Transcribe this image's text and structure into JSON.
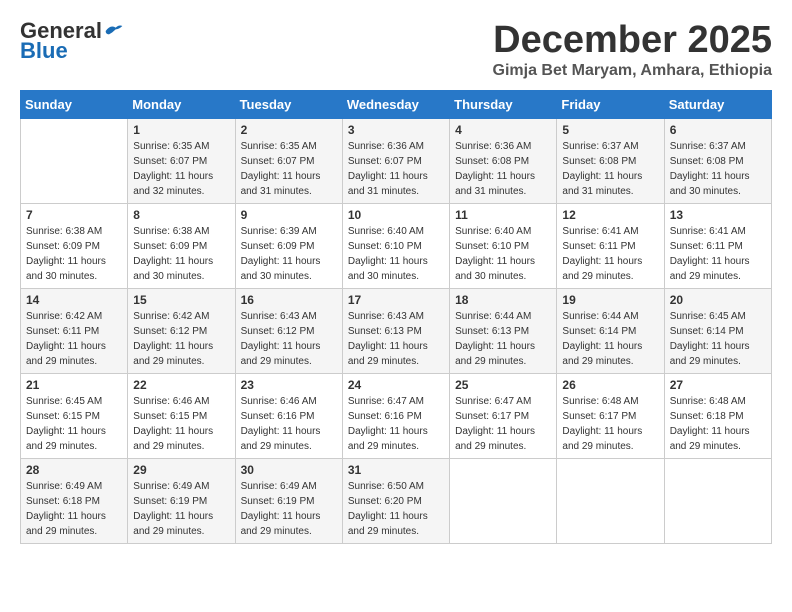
{
  "logo": {
    "general": "General",
    "blue": "Blue"
  },
  "header": {
    "month": "December 2025",
    "location": "Gimja Bet Maryam, Amhara, Ethiopia"
  },
  "weekdays": [
    "Sunday",
    "Monday",
    "Tuesday",
    "Wednesday",
    "Thursday",
    "Friday",
    "Saturday"
  ],
  "weeks": [
    [
      {
        "day": "",
        "sunrise": "",
        "sunset": "",
        "daylight": ""
      },
      {
        "day": "1",
        "sunrise": "Sunrise: 6:35 AM",
        "sunset": "Sunset: 6:07 PM",
        "daylight": "Daylight: 11 hours and 32 minutes."
      },
      {
        "day": "2",
        "sunrise": "Sunrise: 6:35 AM",
        "sunset": "Sunset: 6:07 PM",
        "daylight": "Daylight: 11 hours and 31 minutes."
      },
      {
        "day": "3",
        "sunrise": "Sunrise: 6:36 AM",
        "sunset": "Sunset: 6:07 PM",
        "daylight": "Daylight: 11 hours and 31 minutes."
      },
      {
        "day": "4",
        "sunrise": "Sunrise: 6:36 AM",
        "sunset": "Sunset: 6:08 PM",
        "daylight": "Daylight: 11 hours and 31 minutes."
      },
      {
        "day": "5",
        "sunrise": "Sunrise: 6:37 AM",
        "sunset": "Sunset: 6:08 PM",
        "daylight": "Daylight: 11 hours and 31 minutes."
      },
      {
        "day": "6",
        "sunrise": "Sunrise: 6:37 AM",
        "sunset": "Sunset: 6:08 PM",
        "daylight": "Daylight: 11 hours and 30 minutes."
      }
    ],
    [
      {
        "day": "7",
        "sunrise": "Sunrise: 6:38 AM",
        "sunset": "Sunset: 6:09 PM",
        "daylight": "Daylight: 11 hours and 30 minutes."
      },
      {
        "day": "8",
        "sunrise": "Sunrise: 6:38 AM",
        "sunset": "Sunset: 6:09 PM",
        "daylight": "Daylight: 11 hours and 30 minutes."
      },
      {
        "day": "9",
        "sunrise": "Sunrise: 6:39 AM",
        "sunset": "Sunset: 6:09 PM",
        "daylight": "Daylight: 11 hours and 30 minutes."
      },
      {
        "day": "10",
        "sunrise": "Sunrise: 6:40 AM",
        "sunset": "Sunset: 6:10 PM",
        "daylight": "Daylight: 11 hours and 30 minutes."
      },
      {
        "day": "11",
        "sunrise": "Sunrise: 6:40 AM",
        "sunset": "Sunset: 6:10 PM",
        "daylight": "Daylight: 11 hours and 30 minutes."
      },
      {
        "day": "12",
        "sunrise": "Sunrise: 6:41 AM",
        "sunset": "Sunset: 6:11 PM",
        "daylight": "Daylight: 11 hours and 29 minutes."
      },
      {
        "day": "13",
        "sunrise": "Sunrise: 6:41 AM",
        "sunset": "Sunset: 6:11 PM",
        "daylight": "Daylight: 11 hours and 29 minutes."
      }
    ],
    [
      {
        "day": "14",
        "sunrise": "Sunrise: 6:42 AM",
        "sunset": "Sunset: 6:11 PM",
        "daylight": "Daylight: 11 hours and 29 minutes."
      },
      {
        "day": "15",
        "sunrise": "Sunrise: 6:42 AM",
        "sunset": "Sunset: 6:12 PM",
        "daylight": "Daylight: 11 hours and 29 minutes."
      },
      {
        "day": "16",
        "sunrise": "Sunrise: 6:43 AM",
        "sunset": "Sunset: 6:12 PM",
        "daylight": "Daylight: 11 hours and 29 minutes."
      },
      {
        "day": "17",
        "sunrise": "Sunrise: 6:43 AM",
        "sunset": "Sunset: 6:13 PM",
        "daylight": "Daylight: 11 hours and 29 minutes."
      },
      {
        "day": "18",
        "sunrise": "Sunrise: 6:44 AM",
        "sunset": "Sunset: 6:13 PM",
        "daylight": "Daylight: 11 hours and 29 minutes."
      },
      {
        "day": "19",
        "sunrise": "Sunrise: 6:44 AM",
        "sunset": "Sunset: 6:14 PM",
        "daylight": "Daylight: 11 hours and 29 minutes."
      },
      {
        "day": "20",
        "sunrise": "Sunrise: 6:45 AM",
        "sunset": "Sunset: 6:14 PM",
        "daylight": "Daylight: 11 hours and 29 minutes."
      }
    ],
    [
      {
        "day": "21",
        "sunrise": "Sunrise: 6:45 AM",
        "sunset": "Sunset: 6:15 PM",
        "daylight": "Daylight: 11 hours and 29 minutes."
      },
      {
        "day": "22",
        "sunrise": "Sunrise: 6:46 AM",
        "sunset": "Sunset: 6:15 PM",
        "daylight": "Daylight: 11 hours and 29 minutes."
      },
      {
        "day": "23",
        "sunrise": "Sunrise: 6:46 AM",
        "sunset": "Sunset: 6:16 PM",
        "daylight": "Daylight: 11 hours and 29 minutes."
      },
      {
        "day": "24",
        "sunrise": "Sunrise: 6:47 AM",
        "sunset": "Sunset: 6:16 PM",
        "daylight": "Daylight: 11 hours and 29 minutes."
      },
      {
        "day": "25",
        "sunrise": "Sunrise: 6:47 AM",
        "sunset": "Sunset: 6:17 PM",
        "daylight": "Daylight: 11 hours and 29 minutes."
      },
      {
        "day": "26",
        "sunrise": "Sunrise: 6:48 AM",
        "sunset": "Sunset: 6:17 PM",
        "daylight": "Daylight: 11 hours and 29 minutes."
      },
      {
        "day": "27",
        "sunrise": "Sunrise: 6:48 AM",
        "sunset": "Sunset: 6:18 PM",
        "daylight": "Daylight: 11 hours and 29 minutes."
      }
    ],
    [
      {
        "day": "28",
        "sunrise": "Sunrise: 6:49 AM",
        "sunset": "Sunset: 6:18 PM",
        "daylight": "Daylight: 11 hours and 29 minutes."
      },
      {
        "day": "29",
        "sunrise": "Sunrise: 6:49 AM",
        "sunset": "Sunset: 6:19 PM",
        "daylight": "Daylight: 11 hours and 29 minutes."
      },
      {
        "day": "30",
        "sunrise": "Sunrise: 6:49 AM",
        "sunset": "Sunset: 6:19 PM",
        "daylight": "Daylight: 11 hours and 29 minutes."
      },
      {
        "day": "31",
        "sunrise": "Sunrise: 6:50 AM",
        "sunset": "Sunset: 6:20 PM",
        "daylight": "Daylight: 11 hours and 29 minutes."
      },
      {
        "day": "",
        "sunrise": "",
        "sunset": "",
        "daylight": ""
      },
      {
        "day": "",
        "sunrise": "",
        "sunset": "",
        "daylight": ""
      },
      {
        "day": "",
        "sunrise": "",
        "sunset": "",
        "daylight": ""
      }
    ]
  ]
}
